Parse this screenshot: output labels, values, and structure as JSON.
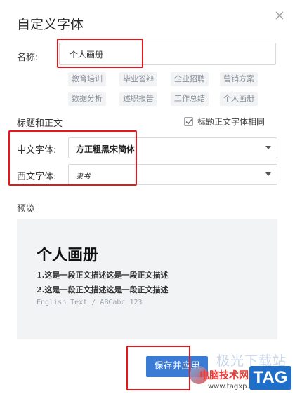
{
  "dialog": {
    "title": "自定义字体"
  },
  "name": {
    "label": "名称:",
    "value": "个人画册",
    "tags": [
      "教育培训",
      "毕业答辩",
      "企业招聘",
      "营销方案",
      "数据分析",
      "述职报告",
      "工作总结",
      "个人画册"
    ]
  },
  "section": {
    "title": "标题和正文",
    "same_font_label": "标题正文字体相同",
    "same_font_checked": true
  },
  "fonts": {
    "chinese_label": "中文字体:",
    "chinese_value": "方正粗黑宋简体",
    "western_label": "西文字体:",
    "western_value": "隶书"
  },
  "preview": {
    "label": "预览",
    "heading": "个人画册",
    "line1": "1.这是一段正文描述这是一段正文描述",
    "line2": "2.这是一段正文描述这是一段正文描述",
    "english": "English Text / ABCabc 123"
  },
  "footer": {
    "save_label": "保存并应用"
  },
  "watermark": {
    "faded": "极光下载站",
    "main": "电脑技术网",
    "url": "www.tagxp.com",
    "tag": "TAG"
  },
  "colors": {
    "accent": "#3a7bd5",
    "highlight": "#e0191c",
    "preview_bg": "#f2f3f5"
  }
}
